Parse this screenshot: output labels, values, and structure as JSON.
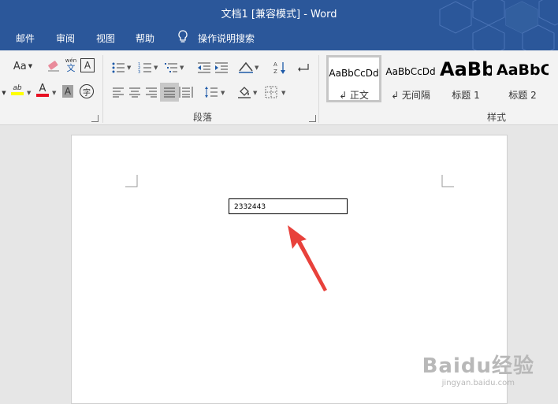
{
  "window": {
    "title": "文档1 [兼容模式]  -  Word"
  },
  "menu": {
    "items": [
      "邮件",
      "审阅",
      "视图",
      "帮助",
      "操作说明搜索"
    ],
    "search_icon": "lightbulb-icon"
  },
  "ribbon": {
    "font_group": {
      "change_case": "Aa",
      "phonetic_guide_text": "wén",
      "phonetic_guide_char": "文",
      "char_border": "A",
      "font_color_label": "A",
      "char_shading": "A",
      "enclosed_char": "字",
      "highlight_text": "ab",
      "colors": {
        "highlight": "#ffff00",
        "font_color": "#e81123",
        "char_shading_bg": "#a0a0a0"
      }
    },
    "paragraph_group": {
      "label": "段落"
    },
    "styles_group": {
      "label": "样式",
      "styles": [
        {
          "sample": "AaBbCcDd",
          "name": "↲ 正文",
          "selected": true
        },
        {
          "sample": "AaBbCcDd",
          "name": "↲ 无间隔",
          "selected": false
        },
        {
          "sample": "AaBb",
          "name": "标题 1",
          "selected": false
        },
        {
          "sample": "AaBbC",
          "name": "标题 2",
          "selected": false
        }
      ]
    }
  },
  "document": {
    "field_value": "2332443"
  },
  "watermark": {
    "brand": "Baidu经验",
    "url": "jingyan.baidu.com"
  },
  "colors": {
    "titlebar": "#2b579a",
    "arrow": "#e8413b"
  }
}
